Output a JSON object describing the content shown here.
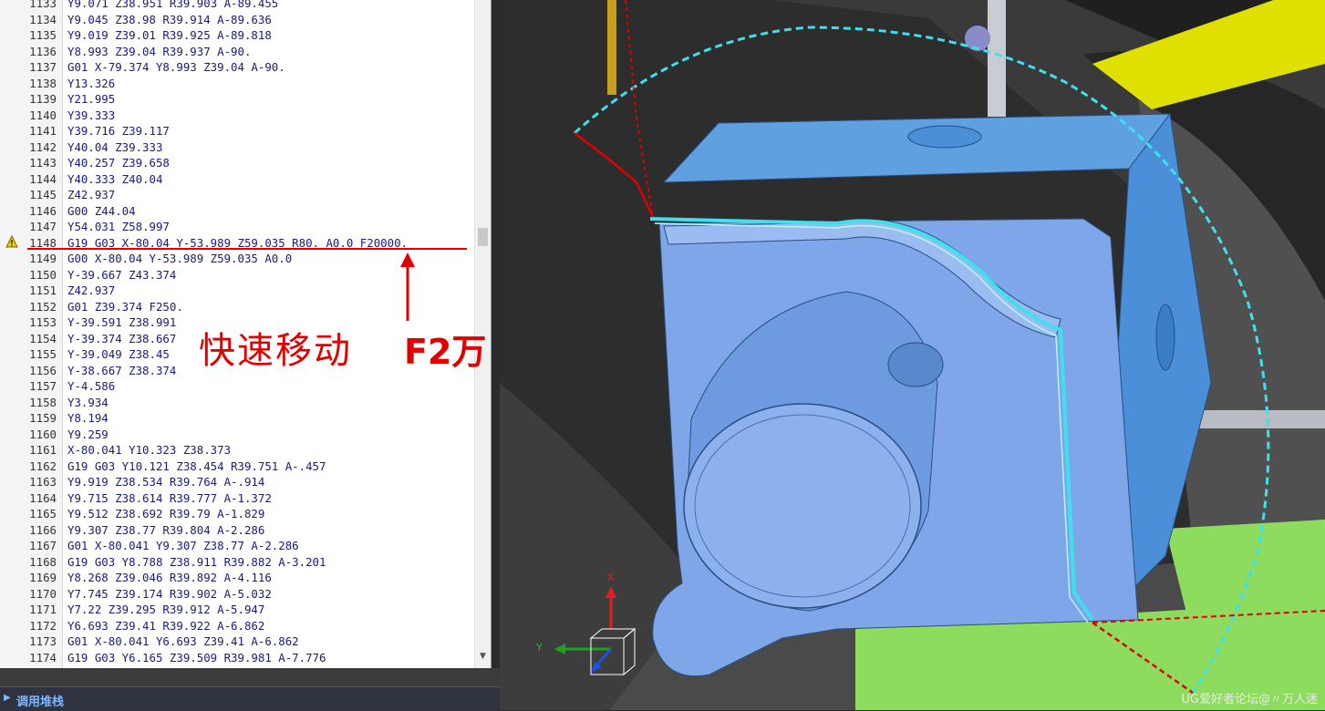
{
  "code_lines": [
    {
      "ln": "1133",
      "text": "Y9.071 Z38.951 R39.903 A-89.455"
    },
    {
      "ln": "1134",
      "text": "Y9.045 Z38.98 R39.914 A-89.636"
    },
    {
      "ln": "1135",
      "text": "Y9.019 Z39.01 R39.925 A-89.818"
    },
    {
      "ln": "1136",
      "text": "Y8.993 Z39.04 R39.937 A-90."
    },
    {
      "ln": "1137",
      "text": "G01 X-79.374 Y8.993 Z39.04 A-90."
    },
    {
      "ln": "1138",
      "text": "Y13.326"
    },
    {
      "ln": "1139",
      "text": "Y21.995"
    },
    {
      "ln": "1140",
      "text": "Y39.333"
    },
    {
      "ln": "1141",
      "text": "Y39.716 Z39.117"
    },
    {
      "ln": "1142",
      "text": "Y40.04 Z39.333"
    },
    {
      "ln": "1143",
      "text": "Y40.257 Z39.658"
    },
    {
      "ln": "1144",
      "text": "Y40.333 Z40.04"
    },
    {
      "ln": "1145",
      "text": "Z42.937"
    },
    {
      "ln": "1146",
      "text": "G00 Z44.04"
    },
    {
      "ln": "1147",
      "text": "Y54.031 Z58.997"
    },
    {
      "ln": "1148",
      "text": "G19 G03 X-80.04 Y-53.989 Z59.035 R80. A0.0 F20000."
    },
    {
      "ln": "1149",
      "text": "G00 X-80.04 Y-53.989 Z59.035 A0.0"
    },
    {
      "ln": "1150",
      "text": "Y-39.667 Z43.374"
    },
    {
      "ln": "1151",
      "text": "Z42.937"
    },
    {
      "ln": "1152",
      "text": "G01 Z39.374 F250."
    },
    {
      "ln": "1153",
      "text": "Y-39.591 Z38.991"
    },
    {
      "ln": "1154",
      "text": "Y-39.374 Z38.667"
    },
    {
      "ln": "1155",
      "text": "Y-39.049 Z38.45"
    },
    {
      "ln": "1156",
      "text": "Y-38.667 Z38.374"
    },
    {
      "ln": "1157",
      "text": "Y-4.586"
    },
    {
      "ln": "1158",
      "text": "Y3.934"
    },
    {
      "ln": "1159",
      "text": "Y8.194"
    },
    {
      "ln": "1160",
      "text": "Y9.259"
    },
    {
      "ln": "1161",
      "text": "X-80.041 Y10.323 Z38.373"
    },
    {
      "ln": "1162",
      "text": "G19 G03 Y10.121 Z38.454 R39.751 A-.457"
    },
    {
      "ln": "1163",
      "text": "Y9.919 Z38.534 R39.764 A-.914"
    },
    {
      "ln": "1164",
      "text": "Y9.715 Z38.614 R39.777 A-1.372"
    },
    {
      "ln": "1165",
      "text": "Y9.512 Z38.692 R39.79 A-1.829"
    },
    {
      "ln": "1166",
      "text": "Y9.307 Z38.77 R39.804 A-2.286"
    },
    {
      "ln": "1167",
      "text": "G01 X-80.041 Y9.307 Z38.77 A-2.286"
    },
    {
      "ln": "1168",
      "text": "G19 G03 Y8.788 Z38.911 R39.882 A-3.201"
    },
    {
      "ln": "1169",
      "text": "Y8.268 Z39.046 R39.892 A-4.116"
    },
    {
      "ln": "1170",
      "text": "Y7.745 Z39.174 R39.902 A-5.032"
    },
    {
      "ln": "1171",
      "text": "Y7.22 Z39.295 R39.912 A-5.947"
    },
    {
      "ln": "1172",
      "text": "Y6.693 Z39.41 R39.922 A-6.862"
    },
    {
      "ln": "1173",
      "text": "G01 X-80.041 Y6.693 Z39.41 A-6.862"
    },
    {
      "ln": "1174",
      "text": "G19 G03 Y6.165 Z39.509 R39.981 A-7.776"
    }
  ],
  "warning_line": "1148",
  "annotations": {
    "rapid_move": "快速移动",
    "feed_note": "F2万"
  },
  "bottom_panel": {
    "title": "调用堆栈"
  },
  "viewport": {
    "axis_x_label": "X",
    "axis_y_label": "Y",
    "watermark": "UG爱好者论坛@〃万人迷"
  },
  "colors": {
    "annotation_red": "#e00000",
    "part_blue": "#7aa4e6",
    "toolpath_cyan": "#3fe0ee",
    "fixture_green": "#8edc5e",
    "tool_yellow": "#e0e000"
  }
}
